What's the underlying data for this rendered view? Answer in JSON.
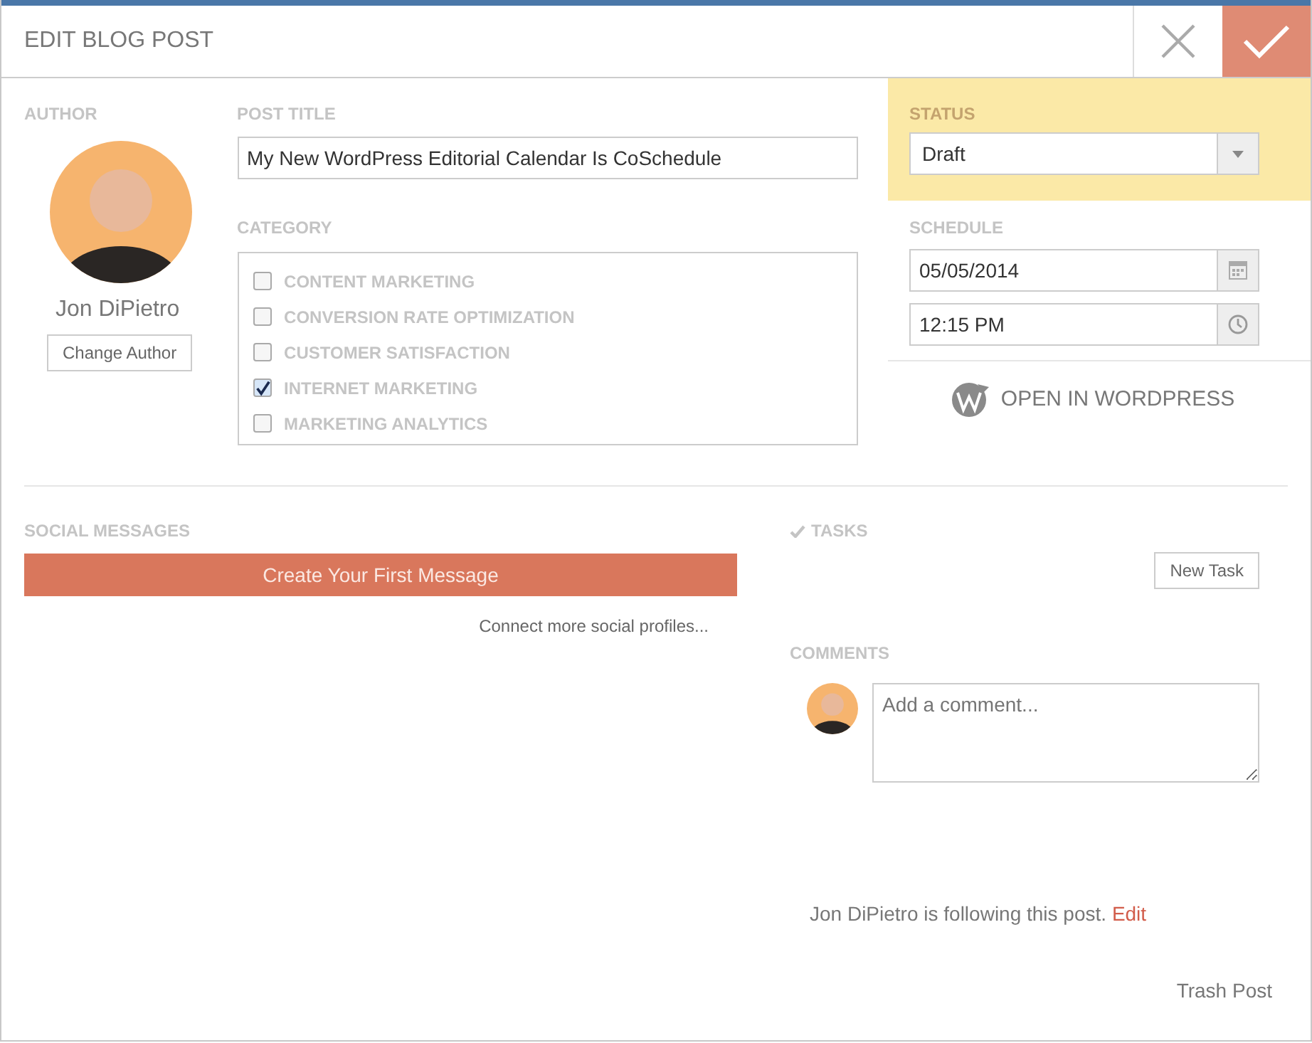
{
  "header": {
    "title": "EDIT BLOG POST"
  },
  "author": {
    "label": "AUTHOR",
    "name": "Jon DiPietro",
    "button": "Change Author"
  },
  "post_title": {
    "label": "POST TITLE",
    "value": "My New WordPress Editorial Calendar Is CoSchedule"
  },
  "category": {
    "label": "CATEGORY",
    "items": [
      {
        "label": "CONTENT MARKETING",
        "checked": false
      },
      {
        "label": "CONVERSION RATE OPTIMIZATION",
        "checked": false
      },
      {
        "label": "CUSTOMER SATISFACTION",
        "checked": false
      },
      {
        "label": "INTERNET MARKETING",
        "checked": true
      },
      {
        "label": "MARKETING ANALYTICS",
        "checked": false
      }
    ]
  },
  "status": {
    "label": "STATUS",
    "value": "Draft"
  },
  "schedule": {
    "label": "SCHEDULE",
    "date": "05/05/2014",
    "time": "12:15 PM"
  },
  "open_wordpress": "OPEN IN WORDPRESS",
  "social": {
    "label": "SOCIAL MESSAGES",
    "button": "Create Your First Message",
    "link": "Connect more social profiles..."
  },
  "tasks": {
    "label": "TASKS",
    "button": "New Task"
  },
  "comments": {
    "label": "COMMENTS",
    "placeholder": "Add a comment..."
  },
  "following": {
    "text": "Jon DiPietro is following this post.",
    "link": "Edit"
  },
  "trash": "Trash Post"
}
